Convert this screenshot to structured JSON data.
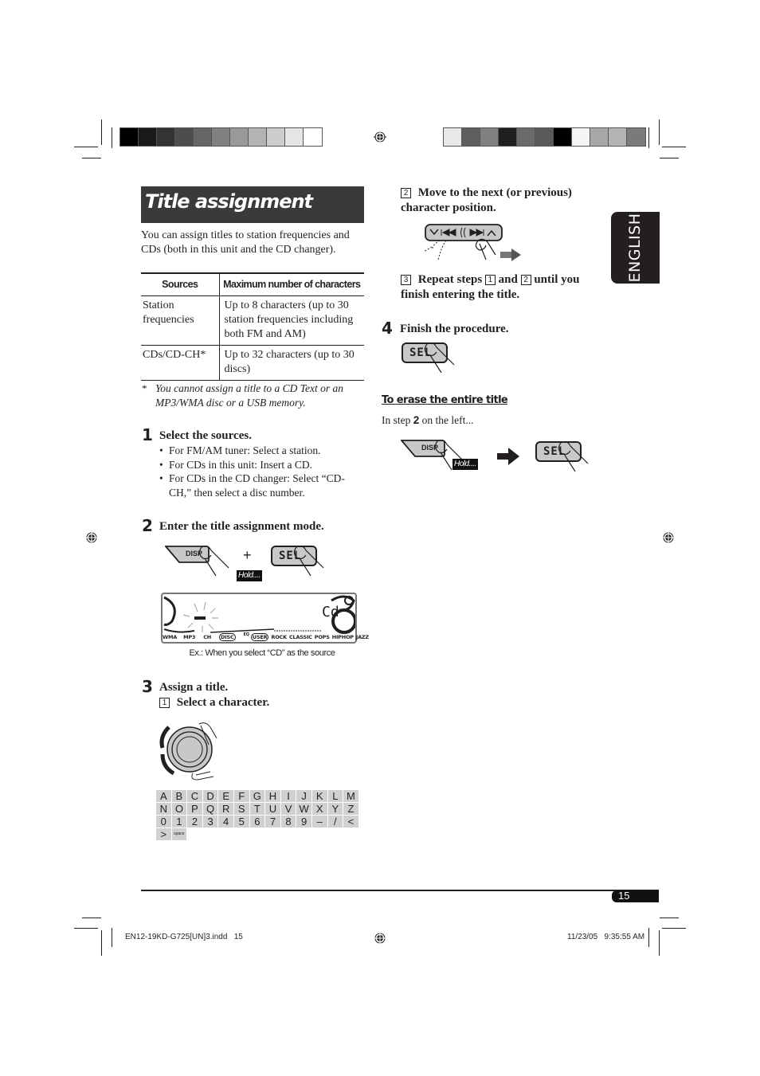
{
  "page": {
    "title": "Title assignment",
    "intro": "You can assign titles to station frequencies and CDs (both in this unit and the CD changer).",
    "language_tab": "ENGLISH",
    "page_number": "15"
  },
  "sources_table": {
    "headers": [
      "Sources",
      "Maximum number of characters"
    ],
    "rows": [
      [
        "Station frequencies",
        "Up to 8 characters (up to 30 station frequencies including both FM and AM)"
      ],
      [
        "CDs/CD-CH*",
        "Up to 32 characters (up to 30 discs)"
      ]
    ],
    "footnote_mark": "*",
    "footnote": "You cannot assign a title to a CD Text or an MP3/WMA disc or a USB memory."
  },
  "steps": [
    {
      "num": "1",
      "heading": "Select the sources.",
      "bullets": [
        "For FM/AM tuner: Select a station.",
        "For CDs in this unit: Insert a CD.",
        "For CDs in the CD changer: Select “CD-CH,” then select a disc number."
      ]
    },
    {
      "num": "2",
      "heading": "Enter the title assignment mode.",
      "plus": "+",
      "hold_label": "Hold....",
      "caption": "Ex.: When you select “CD” as the source"
    },
    {
      "num": "3",
      "heading": "Assign a title.",
      "substeps": [
        {
          "num": "1",
          "text": "Select a character."
        },
        {
          "num": "2",
          "text": "Move to the next (or previous) character position."
        },
        {
          "num": "3",
          "text_before": "Repeat steps",
          "ref1": "1",
          "mid": "and",
          "ref2": "2",
          "text_after": "until you finish entering the title."
        }
      ]
    },
    {
      "num": "4",
      "heading": "Finish the procedure."
    }
  ],
  "buttons": {
    "disp": "DISP",
    "sel": "SEL"
  },
  "lcd": {
    "source_text": "Cd",
    "indicators": [
      "WMA",
      "MP3",
      "CH",
      "DISC",
      "EQ",
      "USER",
      "ROCK",
      "CLASSIC",
      "POPS",
      "HIPHOP",
      "JAZZ"
    ]
  },
  "characters": [
    [
      "A",
      "B",
      "C",
      "D",
      "E",
      "F",
      "G",
      "H",
      "I",
      "J",
      "K",
      "L",
      "M",
      "N"
    ],
    [
      "O",
      "P",
      "Q",
      "R",
      "S",
      "T",
      "U",
      "V",
      "W",
      "X",
      "Y",
      "Z",
      "0",
      "1"
    ],
    [
      "2",
      "3",
      "4",
      "5",
      "6",
      "7",
      "8",
      "9",
      "–",
      "/",
      "<",
      ">",
      "space"
    ]
  ],
  "erase": {
    "heading": "To erase the entire title",
    "text_before": "In step",
    "step_ref": "2",
    "text_after": "on the left...",
    "hold_label": "Hold...."
  },
  "slug": {
    "file": "EN12-19KD-G725[UN]3.indd   15",
    "timestamp": "11/23/05   9:35:55 AM"
  },
  "color_bars": {
    "left": [
      "#000000",
      "#1a1a1a",
      "#333333",
      "#4d4d4d",
      "#666666",
      "#808080",
      "#999999",
      "#b3b3b3",
      "#cccccc",
      "#e6e6e6",
      "#ffffff"
    ],
    "right": [
      "#e8e8e8",
      "#5e5e5e",
      "#808080",
      "#1e1e1e",
      "#6a6a6a",
      "#5a5a5a",
      "#000000",
      "#f4f4f4",
      "#a8a8a8",
      "#b4b4b4",
      "#7a7a7a"
    ]
  }
}
